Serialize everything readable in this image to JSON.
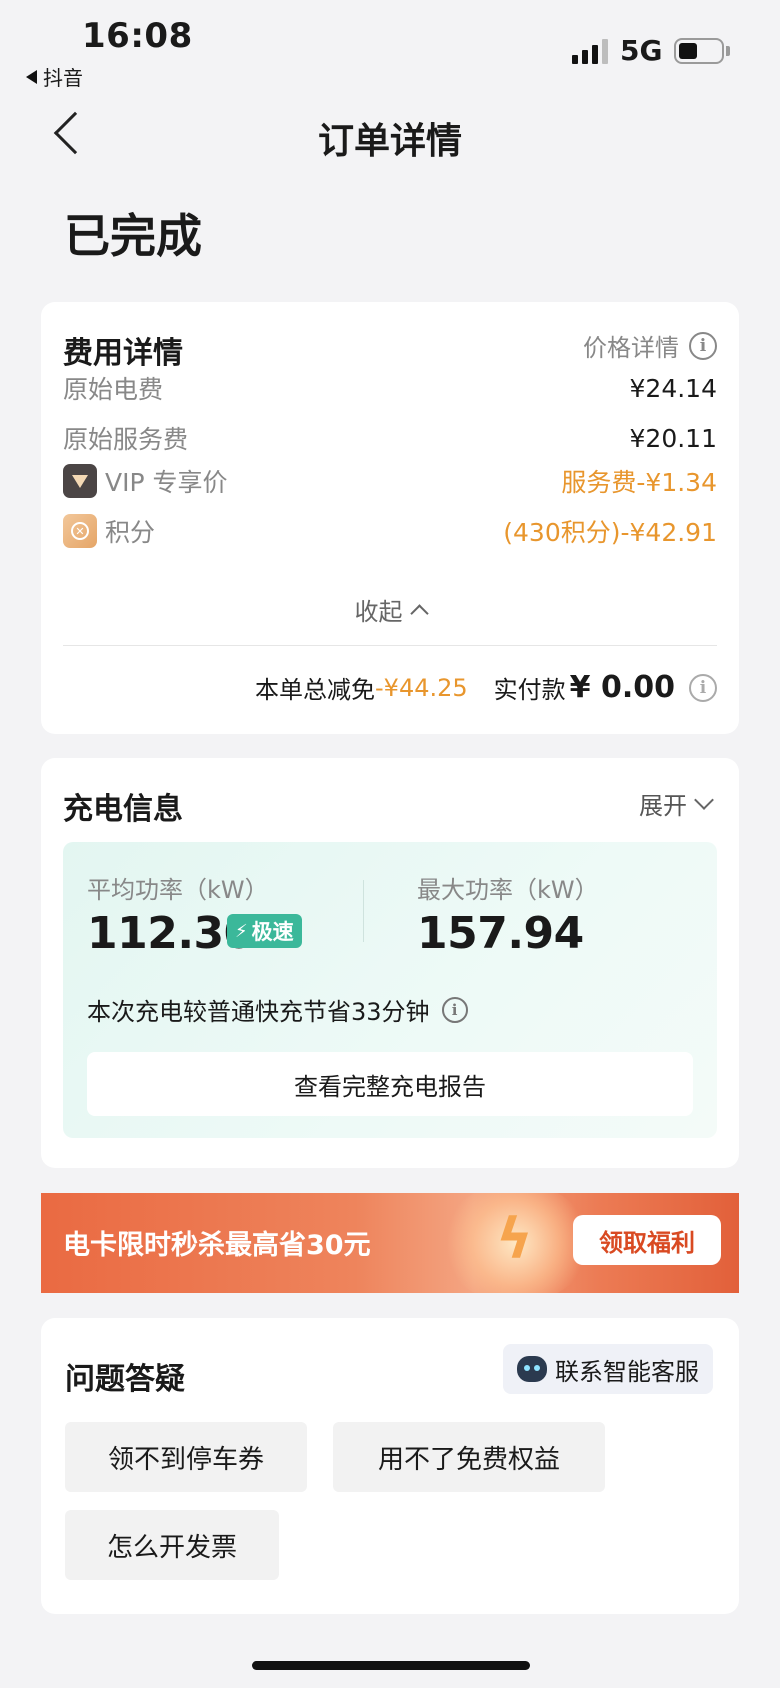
{
  "status_bar": {
    "time": "16:08",
    "back_app": "抖音",
    "network": "5G",
    "battery_level": 0.45
  },
  "nav": {
    "title": "订单详情"
  },
  "order": {
    "status": "已完成"
  },
  "fee_card": {
    "title": "费用详情",
    "price_detail_label": "价格详情",
    "rows": [
      {
        "label": "原始电费",
        "value": "¥24.14",
        "highlight": false
      },
      {
        "label": "原始服务费",
        "value": "¥20.11",
        "highlight": false
      },
      {
        "label": "VIP 专享价",
        "value": "服务费-¥1.34",
        "highlight": true,
        "icon": "vip-diamond-icon"
      },
      {
        "label": "积分",
        "value": "(430积分)-¥42.91",
        "highlight": true,
        "icon": "points-coin-icon"
      }
    ],
    "collapse_label": "收起",
    "total_discount_label": "本单总减免",
    "total_discount_value": "-¥44.25",
    "paid_label": "实付款",
    "paid_value": "¥ 0.00"
  },
  "charge_card": {
    "title": "充电信息",
    "expand_label": "展开",
    "avg_power_label": "平均功率（kW）",
    "avg_power_value": "112.30",
    "fast_badge": "极速",
    "max_power_label": "最大功率（kW）",
    "max_power_value": "157.94",
    "save_note": "本次充电较普通快充节省33分钟",
    "report_button": "查看完整充电报告"
  },
  "banner": {
    "text": "电卡限时秒杀最高省30元",
    "button": "领取福利"
  },
  "faq": {
    "title": "问题答疑",
    "service_button": "联系智能客服",
    "chips": [
      "领不到停车券",
      "用不了免费权益",
      "怎么开发票"
    ]
  },
  "colors": {
    "accent_orange": "#e8962d",
    "fast_green": "#3bb89a",
    "banner_red": "#e2603a"
  }
}
